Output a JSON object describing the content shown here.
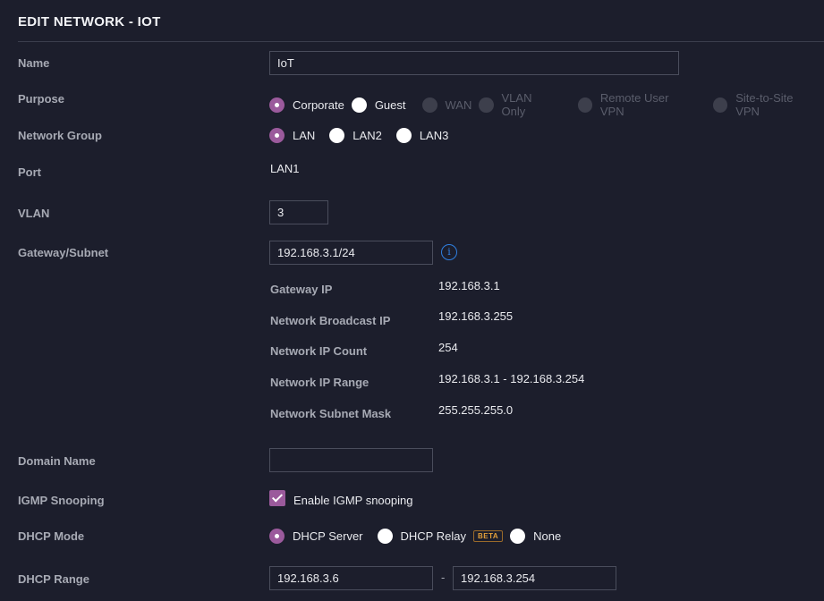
{
  "title": "EDIT NETWORK - IOT",
  "fields": {
    "name": {
      "label": "Name",
      "value": "IoT"
    },
    "purpose": {
      "label": "Purpose",
      "options": [
        {
          "label": "Corporate",
          "checked": true,
          "disabled": false
        },
        {
          "label": "Guest",
          "checked": false,
          "disabled": false
        },
        {
          "label": "WAN",
          "checked": false,
          "disabled": true
        },
        {
          "label": "VLAN Only",
          "checked": false,
          "disabled": true
        },
        {
          "label": "Remote User VPN",
          "checked": false,
          "disabled": true
        },
        {
          "label": "Site-to-Site VPN",
          "checked": false,
          "disabled": true
        }
      ]
    },
    "network_group": {
      "label": "Network Group",
      "options": [
        {
          "label": "LAN",
          "checked": true
        },
        {
          "label": "LAN2",
          "checked": false
        },
        {
          "label": "LAN3",
          "checked": false
        }
      ]
    },
    "port": {
      "label": "Port",
      "value": "LAN1"
    },
    "vlan": {
      "label": "VLAN",
      "value": "3"
    },
    "gateway_subnet": {
      "label": "Gateway/Subnet",
      "value": "192.168.3.1/24",
      "info_icon": "info-icon"
    },
    "subnet_info": [
      {
        "label": "Gateway IP",
        "value": "192.168.3.1"
      },
      {
        "label": "Network Broadcast IP",
        "value": "192.168.3.255"
      },
      {
        "label": "Network IP Count",
        "value": "254"
      },
      {
        "label": "Network IP Range",
        "value": "192.168.3.1 - 192.168.3.254"
      },
      {
        "label": "Network Subnet Mask",
        "value": "255.255.255.0"
      }
    ],
    "domain_name": {
      "label": "Domain Name",
      "value": ""
    },
    "igmp": {
      "label": "IGMP Snooping",
      "checkbox_label": "Enable IGMP snooping",
      "checked": true
    },
    "dhcp_mode": {
      "label": "DHCP Mode",
      "options": [
        {
          "label": "DHCP Server",
          "checked": true
        },
        {
          "label": "DHCP Relay",
          "checked": false,
          "badge": "BETA"
        },
        {
          "label": "None",
          "checked": false
        }
      ]
    },
    "dhcp_range": {
      "label": "DHCP Range",
      "start": "192.168.3.6",
      "separator": "-",
      "end": "192.168.3.254"
    }
  },
  "colors": {
    "accent": "#9b5a9c",
    "info": "#2f7fe0",
    "beta": "#e3a03a",
    "background": "#1c1e2c"
  }
}
